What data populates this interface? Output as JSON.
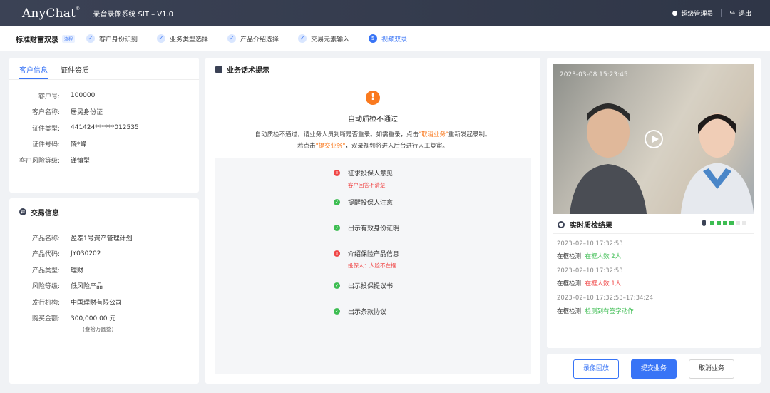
{
  "header": {
    "logo": "AnyChat",
    "logo_mark": "®",
    "system_name": "录音录像系统  SIT – V1.0",
    "user": "超级管理员",
    "logout": "退出"
  },
  "steps_bar": {
    "title": "标准财富双录",
    "tag": "流程",
    "steps": [
      {
        "label": "客户身份识别",
        "icon": "✓"
      },
      {
        "label": "业务类型选择",
        "icon": "✓"
      },
      {
        "label": "产品介绍选择",
        "icon": "✓"
      },
      {
        "label": "交易元素输入",
        "icon": "✓"
      },
      {
        "label": "视频双录",
        "icon": "5"
      }
    ]
  },
  "customer": {
    "tabs": [
      "客户信息",
      "证件资质"
    ],
    "fields": [
      {
        "k": "客户号:",
        "v": "100000"
      },
      {
        "k": "客户名称:",
        "v": "居民身份证"
      },
      {
        "k": "证件类型:",
        "v": "441424******012535"
      },
      {
        "k": "证件号码:",
        "v": "饶*峰"
      },
      {
        "k": "客户风险等级:",
        "v": "谨慎型"
      }
    ]
  },
  "trade": {
    "title": "交易信息",
    "fields": [
      {
        "k": "产品名称:",
        "v": "盈泰1号资产管理计划"
      },
      {
        "k": "产品代码:",
        "v": "JY030202"
      },
      {
        "k": "产品类型:",
        "v": "理财"
      },
      {
        "k": "风险等级:",
        "v": "低风险产品"
      },
      {
        "k": "发行机构:",
        "v": "中国理财有限公司"
      },
      {
        "k": "购买金额:",
        "v": "300,000.00  元"
      }
    ],
    "amount_note": "(叁拾万圆整)"
  },
  "script": {
    "title": "业务话术提示",
    "warn_icon": "!",
    "warn_title": "自动质检不通过",
    "line1_a": "自动质检不通过，请业务人员判断是否重录。如需重录，点击",
    "line1_hl": "\"取消业务\"",
    "line1_b": "重新发起录制。",
    "line2_a": "若点击",
    "line2_hl": "\"提交业务\"",
    "line2_b": "，双录视频将进入后台进行人工复审。",
    "items": [
      {
        "label": "征求投保人意见",
        "status": "fail",
        "icon": "×",
        "error": "客户回答不清楚"
      },
      {
        "label": "提醒投保人注意",
        "status": "ok",
        "icon": "✓",
        "error": ""
      },
      {
        "label": "出示有效身份证明",
        "status": "ok",
        "icon": "✓",
        "error": ""
      },
      {
        "label": "介绍保险产品信息",
        "status": "fail",
        "icon": "×",
        "error": "投保人：人脸不在框"
      },
      {
        "label": "出示投保提议书",
        "status": "ok",
        "icon": "✓",
        "error": ""
      },
      {
        "label": "出示条款协议",
        "status": "ok",
        "icon": "✓",
        "error": ""
      }
    ]
  },
  "video": {
    "timestamp": "2023-03-08 15:23:45",
    "qc_title": "实时质检结果",
    "audio_level": "4 of 6",
    "records": [
      {
        "time": "2023–02–10  17:32:53",
        "label": "在框检测:",
        "value": "在框人数 2人",
        "color": "green"
      },
      {
        "time": "2023–02–10  17:32:53",
        "label": "在框检测:",
        "value": "在框人数 1人",
        "color": "red"
      },
      {
        "time": "2023–02–10  17:32:53–17:34:24",
        "label": "在框检测:",
        "value": "检测到有签字动作",
        "color": "green"
      }
    ]
  },
  "actions": {
    "playback": "录像回放",
    "submit": "提交业务",
    "cancel": "取消业务"
  },
  "colors": {
    "accent": "#3874f6",
    "header_bg": "#3b4255",
    "warn": "#fa7a1f",
    "fail": "#f04545",
    "ok": "#3dbd52"
  }
}
